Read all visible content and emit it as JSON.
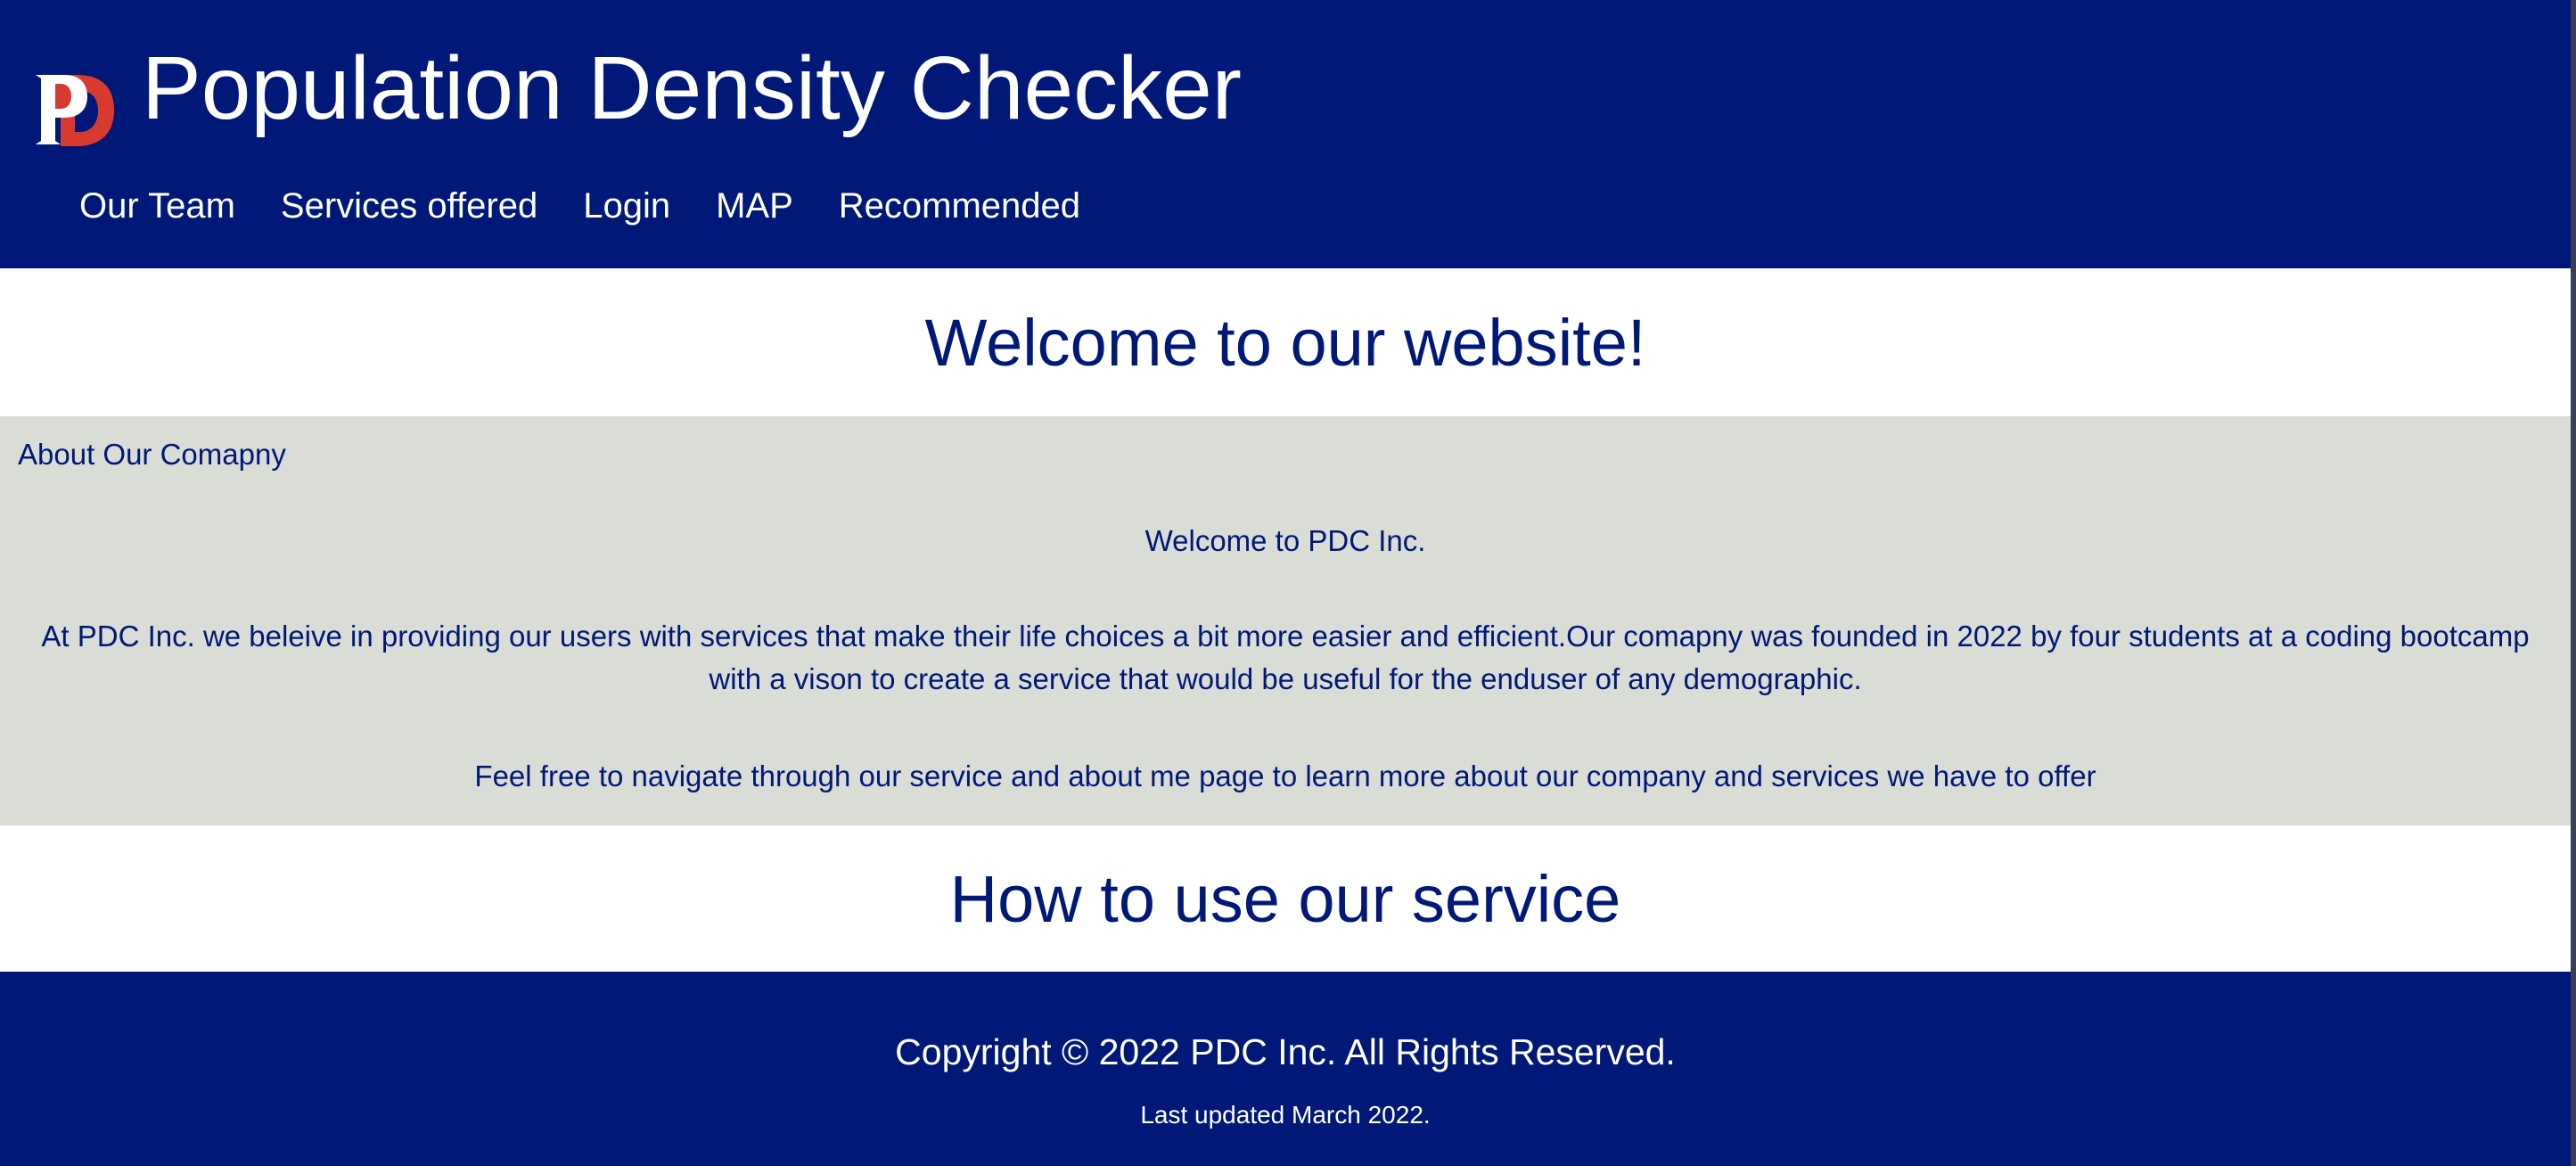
{
  "colors": {
    "brand_navy": "#001877",
    "about_background": "#d9ddd6",
    "logo_red": "#d93a30",
    "text_white": "#ffffff"
  },
  "header": {
    "logo_icon": "pd-monogram-logo",
    "title": "Population Density Checker",
    "nav": [
      {
        "label": "Our Team"
      },
      {
        "label": "Services offered"
      },
      {
        "label": "Login"
      },
      {
        "label": "MAP"
      },
      {
        "label": "Recommended"
      }
    ]
  },
  "welcome": {
    "heading": "Welcome to our website!"
  },
  "about": {
    "heading": "About Our Comapny",
    "welcome_line": "Welcome to PDC Inc.",
    "description": "At PDC Inc. we beleive in providing our users with services that make their life choices a bit more easier and efficient.Our comapny was founded in 2022 by four students at a coding bootcamp with a vison to create a service that would be useful for the enduser of any demographic.",
    "navigate_line": "Feel free to navigate through our service and about me page to learn more about our company and services we have to offer"
  },
  "howto": {
    "heading": "How to use our service"
  },
  "footer": {
    "copyright": "Copyright © 2022 PDC Inc. All Rights Reserved.",
    "last_updated": "Last updated March 2022."
  }
}
